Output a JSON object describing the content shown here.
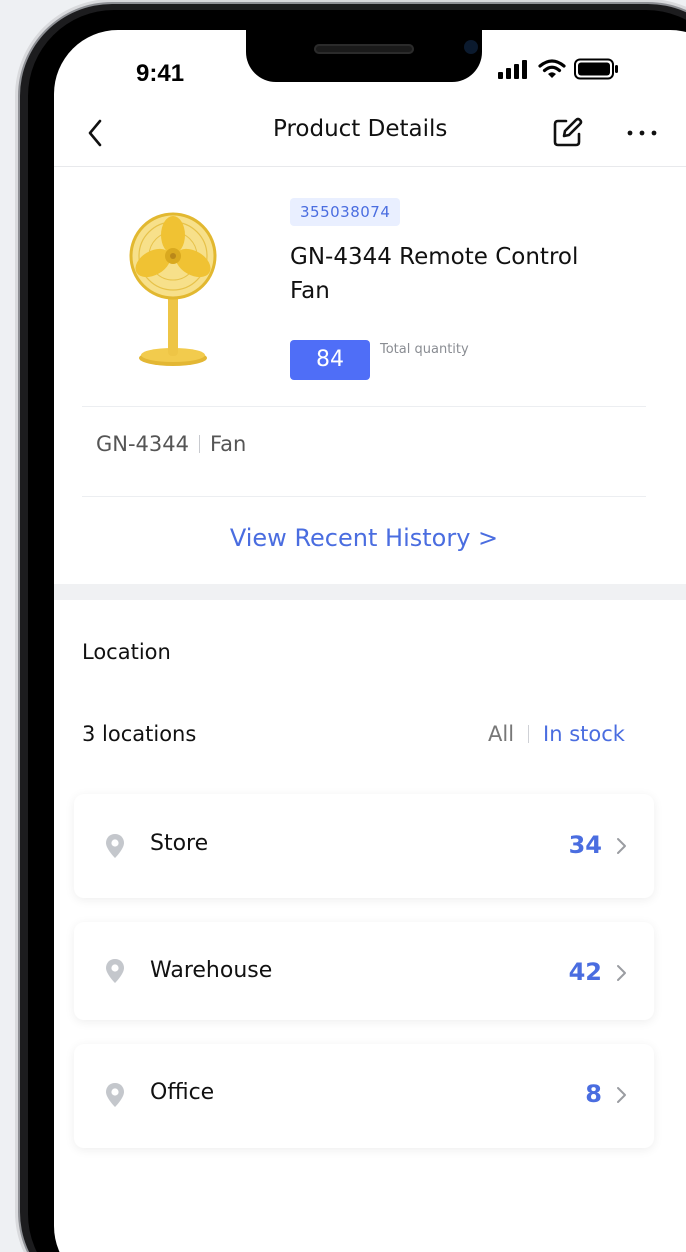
{
  "status_bar": {
    "time": "9:41"
  },
  "nav": {
    "title": "Product Details"
  },
  "product": {
    "sku": "355038074",
    "name": "GN-4344 Remote Control Fan",
    "quantity": "84",
    "quantity_label": "Total quantity",
    "model": "GN-4344",
    "category": "Fan"
  },
  "history_link": "View Recent History >",
  "location": {
    "title": "Location",
    "count_label": "3 locations",
    "filter_all": "All",
    "filter_in_stock": "In stock",
    "items": [
      {
        "name": "Store",
        "count": "34"
      },
      {
        "name": "Warehouse",
        "count": "42"
      },
      {
        "name": "Office",
        "count": "8"
      }
    ]
  },
  "colors": {
    "accent": "#4a6de0",
    "quantity_badge": "#4f6ef7",
    "sku_badge_bg": "#e9efff",
    "fan_yellow": "#f2c94c"
  },
  "icons": {
    "back": "chevron-left-icon",
    "edit": "edit-icon",
    "more": "more-icon",
    "location": "location-pin-icon",
    "row_chevron": "chevron-right-icon"
  }
}
